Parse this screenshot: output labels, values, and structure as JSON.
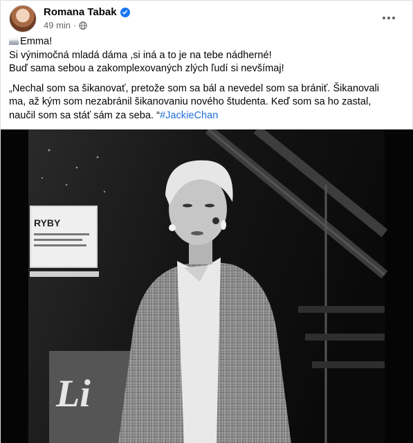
{
  "post": {
    "author": "Romana Tabak",
    "time": "49 min",
    "separator": "·",
    "lines": [
      "Emma!",
      "Si výnimočná mladá dáma ,si iná a to je na tebe nádherné!",
      "Buď sama sebou a zakomplexovaných zlých ľudí si nevšímaj!"
    ],
    "quote_lines": [
      "„Nechal som sa šikanovať, pretože som sa bál a nevedel som sa brániť. Šikanovali",
      "ma, až kým som nezabránil šikanovaniu nového študenta. Keď som sa ho zastal,",
      "naučil som sa stáť sám za seba. “"
    ],
    "hashtag": "#JackieChan"
  },
  "photo": {
    "sign_top": "RYBY",
    "sign_big": "Li"
  },
  "icons": {
    "verified": "verified-badge-icon",
    "audience": "globe-icon",
    "more": "more-options-icon",
    "flag": "flag-icon"
  },
  "colors": {
    "verified": "#1877f2",
    "link": "#216fdb",
    "meta": "#65676b"
  }
}
